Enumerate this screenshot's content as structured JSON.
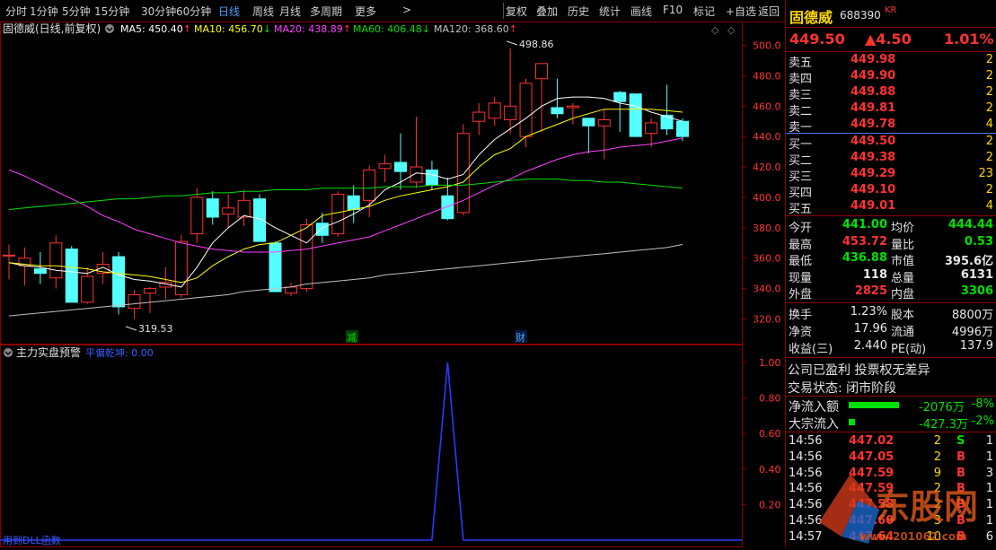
{
  "toolbar": {
    "periods": [
      "分时",
      "1分钟",
      "5分钟",
      "15分钟",
      "30分钟",
      "60分钟",
      "日线",
      "周线",
      "月线",
      "多周期",
      "更多"
    ],
    "active_period": "日线",
    "more_arrow": ">",
    "actions": [
      "复权",
      "叠加",
      "历史",
      "统计",
      "画线",
      "F10",
      "标记",
      "+自选",
      "返回"
    ]
  },
  "main_chart": {
    "title": "固德威(日线,前复权)",
    "ma": [
      {
        "label": "MA5: 450.40",
        "arrow": "↑",
        "color": "#ffffff"
      },
      {
        "label": "MA10: 456.70",
        "arrow": "↓",
        "color": "#ffff00"
      },
      {
        "label": "MA20: 438.89",
        "arrow": "↑",
        "color": "#ff40ff"
      },
      {
        "label": "MA60: 406.48",
        "arrow": "↓",
        "color": "#00e000"
      },
      {
        "label": "MA120: 368.60",
        "arrow": "↑",
        "color": "#c0c0c0"
      }
    ],
    "high_label": "498.86",
    "low_label": "319.53",
    "markers": [
      "减",
      "财"
    ],
    "y_axis": [
      "500.0",
      "480.0",
      "460.0",
      "440.0",
      "420.0",
      "400.0",
      "380.0",
      "360.0",
      "340.0",
      "320.0"
    ],
    "controls": [
      "◇",
      "◇"
    ]
  },
  "chart_data": {
    "type": "candlestick",
    "ylim": [
      315,
      505
    ],
    "candles": [
      {
        "o": 362,
        "h": 369,
        "l": 346,
        "c": 362
      },
      {
        "o": 355,
        "h": 367,
        "l": 342,
        "c": 360
      },
      {
        "o": 353,
        "h": 364,
        "l": 343,
        "c": 350
      },
      {
        "o": 347,
        "h": 375,
        "l": 340,
        "c": 370
      },
      {
        "o": 366,
        "h": 368,
        "l": 333,
        "c": 331
      },
      {
        "o": 331,
        "h": 354,
        "l": 330,
        "c": 348
      },
      {
        "o": 350,
        "h": 364,
        "l": 343,
        "c": 356
      },
      {
        "o": 361,
        "h": 364,
        "l": 323,
        "c": 328
      },
      {
        "o": 327,
        "h": 339,
        "l": 320,
        "c": 336
      },
      {
        "o": 337,
        "h": 341,
        "l": 324,
        "c": 340
      },
      {
        "o": 341,
        "h": 354,
        "l": 333,
        "c": 344
      },
      {
        "o": 336,
        "h": 375,
        "l": 334,
        "c": 371
      },
      {
        "o": 376,
        "h": 406,
        "l": 370,
        "c": 400
      },
      {
        "o": 399,
        "h": 404,
        "l": 382,
        "c": 387
      },
      {
        "o": 389,
        "h": 402,
        "l": 380,
        "c": 393
      },
      {
        "o": 387,
        "h": 405,
        "l": 381,
        "c": 398
      },
      {
        "o": 399,
        "h": 402,
        "l": 372,
        "c": 371
      },
      {
        "o": 370,
        "h": 371,
        "l": 339,
        "c": 338
      },
      {
        "o": 337,
        "h": 344,
        "l": 335,
        "c": 341
      },
      {
        "o": 340,
        "h": 386,
        "l": 338,
        "c": 382
      },
      {
        "o": 383,
        "h": 390,
        "l": 370,
        "c": 375
      },
      {
        "o": 376,
        "h": 404,
        "l": 374,
        "c": 402
      },
      {
        "o": 401,
        "h": 408,
        "l": 383,
        "c": 392
      },
      {
        "o": 398,
        "h": 421,
        "l": 387,
        "c": 418
      },
      {
        "o": 419,
        "h": 428,
        "l": 410,
        "c": 422
      },
      {
        "o": 423,
        "h": 442,
        "l": 405,
        "c": 417
      },
      {
        "o": 410,
        "h": 453,
        "l": 406,
        "c": 420
      },
      {
        "o": 418,
        "h": 424,
        "l": 405,
        "c": 408
      },
      {
        "o": 401,
        "h": 413,
        "l": 385,
        "c": 386
      },
      {
        "o": 390,
        "h": 448,
        "l": 388,
        "c": 442
      },
      {
        "o": 450,
        "h": 462,
        "l": 441,
        "c": 456
      },
      {
        "o": 452,
        "h": 466,
        "l": 447,
        "c": 462
      },
      {
        "o": 451,
        "h": 498,
        "l": 442,
        "c": 460
      },
      {
        "o": 440,
        "h": 478,
        "l": 433,
        "c": 475
      },
      {
        "o": 478,
        "h": 488,
        "l": 443,
        "c": 488
      },
      {
        "o": 459,
        "h": 478,
        "l": 452,
        "c": 455
      },
      {
        "o": 459,
        "h": 462,
        "l": 448,
        "c": 460
      },
      {
        "o": 452,
        "h": 447,
        "l": 429,
        "c": 447
      },
      {
        "o": 447,
        "h": 458,
        "l": 425,
        "c": 451
      },
      {
        "o": 469,
        "h": 470,
        "l": 443,
        "c": 463
      },
      {
        "o": 468,
        "h": 466,
        "l": 440,
        "c": 440
      },
      {
        "o": 442,
        "h": 452,
        "l": 433,
        "c": 449
      },
      {
        "o": 454,
        "h": 474,
        "l": 441,
        "c": 445
      },
      {
        "o": 450,
        "h": 452,
        "l": 437,
        "c": 440
      }
    ],
    "ma5": [
      357,
      355,
      354,
      352,
      351,
      350,
      354,
      349,
      346,
      345,
      343,
      341,
      354,
      370,
      380,
      388,
      386,
      380,
      375,
      370,
      380,
      384,
      389,
      395,
      405,
      410,
      416,
      415,
      412,
      415,
      428,
      438,
      445,
      452,
      460,
      465,
      466,
      466,
      465,
      462,
      460,
      456,
      453,
      450
    ],
    "ma10": [
      357,
      356,
      355,
      355,
      354,
      353,
      351,
      350,
      349,
      348,
      346,
      344,
      347,
      355,
      361,
      366,
      369,
      370,
      375,
      380,
      388,
      390,
      392,
      394,
      398,
      401,
      403,
      405,
      407,
      410,
      420,
      428,
      432,
      440,
      444,
      448,
      452,
      455,
      458,
      458,
      458,
      458,
      457,
      456
    ],
    "ma20": [
      418,
      414,
      409,
      404,
      399,
      394,
      388,
      384,
      379,
      376,
      373,
      370,
      368,
      366,
      365,
      364,
      364,
      364,
      365,
      366,
      368,
      370,
      372,
      374,
      378,
      382,
      386,
      390,
      394,
      398,
      403,
      408,
      412,
      417,
      421,
      425,
      428,
      430,
      431,
      433,
      434,
      435,
      437,
      439
    ],
    "ma60": [
      392,
      393,
      394,
      395,
      396,
      397,
      398,
      399,
      399,
      400,
      401,
      401,
      402,
      403,
      403,
      404,
      404,
      405,
      405,
      405,
      406,
      406,
      406,
      406,
      407,
      407,
      407,
      408,
      408,
      408,
      409,
      410,
      411,
      412,
      412,
      412,
      411,
      411,
      410,
      410,
      409,
      408,
      407,
      406
    ],
    "ma120": [
      322,
      323,
      324,
      325,
      326,
      327,
      328,
      329,
      330,
      331,
      332,
      333,
      334,
      335,
      336,
      338,
      339,
      340,
      341,
      343,
      344,
      345,
      346,
      347,
      349,
      350,
      351,
      352,
      353,
      354,
      355,
      356,
      357,
      358,
      359,
      360,
      361,
      362,
      363,
      364,
      365,
      366,
      367,
      369
    ]
  },
  "indicator": {
    "title": "主力实盘预警",
    "series_label": "平偏乾坤: 0.00",
    "y_axis": [
      "1.00",
      "0.80",
      "0.60",
      "0.40",
      "0.20"
    ],
    "bottom_note": "用到DLL函数",
    "values": [
      0,
      0,
      0,
      0,
      0,
      0,
      0,
      0,
      0,
      0,
      0,
      0,
      0,
      0,
      0,
      0,
      0,
      0,
      0,
      0,
      0,
      0,
      0,
      0,
      0,
      0,
      0,
      0,
      1,
      0,
      0,
      0,
      0,
      0,
      0,
      0,
      0,
      0,
      0,
      0,
      0,
      0,
      0,
      0
    ]
  },
  "quote": {
    "name": "固德威",
    "code": "688390",
    "tag": "KR",
    "price": "449.50",
    "change": "▲4.50",
    "change_pct": "1.01%",
    "asks": [
      {
        "label": "卖五",
        "price": "449.98",
        "vol": "2"
      },
      {
        "label": "卖四",
        "price": "449.90",
        "vol": "2"
      },
      {
        "label": "卖三",
        "price": "449.88",
        "vol": "2"
      },
      {
        "label": "卖二",
        "price": "449.81",
        "vol": "2"
      },
      {
        "label": "卖一",
        "price": "449.78",
        "vol": "4"
      }
    ],
    "bids": [
      {
        "label": "买一",
        "price": "449.50",
        "vol": "2"
      },
      {
        "label": "买二",
        "price": "449.38",
        "vol": "2"
      },
      {
        "label": "买三",
        "price": "449.29",
        "vol": "23"
      },
      {
        "label": "买四",
        "price": "449.10",
        "vol": "2"
      },
      {
        "label": "买五",
        "price": "449.01",
        "vol": "4"
      }
    ],
    "stats": [
      {
        "l1": "今开",
        "v1": "441.00",
        "c1": "green",
        "l2": "均价",
        "v2": "444.44",
        "c2": "green"
      },
      {
        "l1": "最高",
        "v1": "453.72",
        "c1": "red",
        "l2": "量比",
        "v2": "0.53",
        "c2": "green"
      },
      {
        "l1": "最低",
        "v1": "436.88",
        "c1": "green",
        "l2": "市值",
        "v2": "395.6亿",
        "c2": "white"
      },
      {
        "l1": "现量",
        "v1": "118",
        "c1": "white",
        "l2": "总量",
        "v2": "6131",
        "c2": "white"
      },
      {
        "l1": "外盘",
        "v1": "2825",
        "c1": "red",
        "l2": "内盘",
        "v2": "3306",
        "c2": "green"
      }
    ],
    "stats2": [
      {
        "l1": "换手",
        "v1": "1.23%",
        "l2": "股本",
        "v2": "8800万"
      },
      {
        "l1": "净资",
        "v1": "17.96",
        "l2": "流通",
        "v2": "4996万"
      },
      {
        "l1": "收益(三)",
        "v1": "2.440",
        "l2": "PE(动)",
        "v2": "137.9"
      }
    ],
    "info1": "公司已盈利 投票权无差异",
    "info2": "交易状态: 闭市阶段",
    "flows": [
      {
        "label": "净流入额",
        "value": "-2076万",
        "pct": "-8%",
        "bar": 0.8
      },
      {
        "label": "大宗流入",
        "value": "-427.3万",
        "pct": "-2%",
        "bar": 0.1
      }
    ],
    "ticks": [
      {
        "time": "14:56",
        "price": "447.02",
        "vol": "2",
        "side": "S",
        "n": "1"
      },
      {
        "time": "14:56",
        "price": "447.05",
        "vol": "2",
        "side": "B",
        "n": "1"
      },
      {
        "time": "14:56",
        "price": "447.59",
        "vol": "9",
        "side": "B",
        "n": "3"
      },
      {
        "time": "14:56",
        "price": "447.59",
        "vol": "2",
        "side": "B",
        "n": "1"
      },
      {
        "time": "14:56",
        "price": "447.58",
        "vol": "2",
        "side": "B",
        "n": "1"
      },
      {
        "time": "14:56",
        "price": "447.60",
        "vol": "3",
        "side": "B",
        "n": "1"
      },
      {
        "time": "14:57",
        "price": "447.64",
        "vol": "10",
        "side": "B",
        "n": "6"
      }
    ],
    "watermark": "东股网",
    "watermark_url": "www.201062.com"
  }
}
